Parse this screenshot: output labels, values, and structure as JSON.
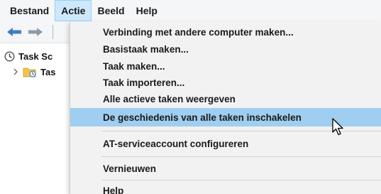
{
  "menubar": {
    "items": [
      "Bestand",
      "Actie",
      "Beeld",
      "Help"
    ],
    "active_index": 1
  },
  "tree": {
    "items": [
      {
        "label": "Task Sc",
        "icon": "clock-icon"
      },
      {
        "label": "Tas",
        "icon": "folder-clock-icon"
      }
    ]
  },
  "action_menu": {
    "items": [
      "Verbinding met andere computer maken...",
      "Basistaak maken...",
      "Taak maken...",
      "Taak importeren...",
      "Alle actieve taken weergeven",
      "De geschiedenis van alle taken inschakelen",
      "AT-serviceaccount configureren",
      "Vernieuwen",
      "Help"
    ],
    "highlighted_index": 5
  },
  "colors": {
    "highlight": "#9fcef0",
    "menubar_active": "#cde8fb",
    "arrow_blue": "#3b7fc4"
  }
}
